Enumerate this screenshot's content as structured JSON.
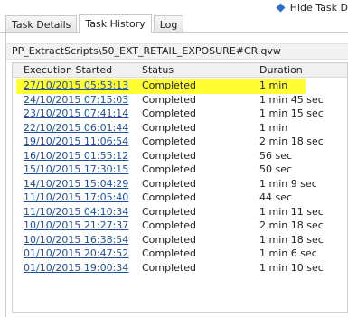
{
  "header": {
    "hide_task_label": "Hide Task D"
  },
  "tabs": [
    {
      "label": "Task Details",
      "active": false
    },
    {
      "label": "Task History",
      "active": true
    },
    {
      "label": "Log",
      "active": false
    }
  ],
  "task_path": "PP_ExtractScripts\\50_EXT_RETAIL_EXPOSURE#CR.qvw",
  "table": {
    "columns": [
      "Execution Started",
      "Status",
      "Duration"
    ],
    "rows": [
      {
        "started": "27/10/2015 05:53:13",
        "status": "Completed",
        "duration": "1 min"
      },
      {
        "started": "24/10/2015 07:15:03",
        "status": "Completed",
        "duration": "1 min 45 sec"
      },
      {
        "started": "23/10/2015 07:41:14",
        "status": "Completed",
        "duration": "1 min 15 sec"
      },
      {
        "started": "22/10/2015 06:01:44",
        "status": "Completed",
        "duration": "1 min"
      },
      {
        "started": "19/10/2015 11:06:54",
        "status": "Completed",
        "duration": "2 min 18 sec"
      },
      {
        "started": "16/10/2015 01:55:12",
        "status": "Completed",
        "duration": "56 sec"
      },
      {
        "started": "15/10/2015 17:30:15",
        "status": "Completed",
        "duration": "50 sec"
      },
      {
        "started": "14/10/2015 15:04:29",
        "status": "Completed",
        "duration": "1 min 9 sec"
      },
      {
        "started": "11/10/2015 17:05:40",
        "status": "Completed",
        "duration": "44 sec"
      },
      {
        "started": "11/10/2015 04:10:34",
        "status": "Completed",
        "duration": "1 min 11 sec"
      },
      {
        "started": "10/10/2015 21:27:37",
        "status": "Completed",
        "duration": "2 min 18 sec"
      },
      {
        "started": "10/10/2015 16:38:54",
        "status": "Completed",
        "duration": "1 min 18 sec"
      },
      {
        "started": "01/10/2015 20:47:52",
        "status": "Completed",
        "duration": "1 min 6 sec"
      },
      {
        "started": "01/10/2015 19:00:34",
        "status": "Completed",
        "duration": "1 min 10 sec"
      }
    ],
    "highlighted_row": 0
  },
  "colors": {
    "link": "#1f4f9a",
    "highlight": "#ffff33",
    "icon": "#2b6fc7"
  },
  "icons": {
    "hide_task": "diamond-icon"
  }
}
